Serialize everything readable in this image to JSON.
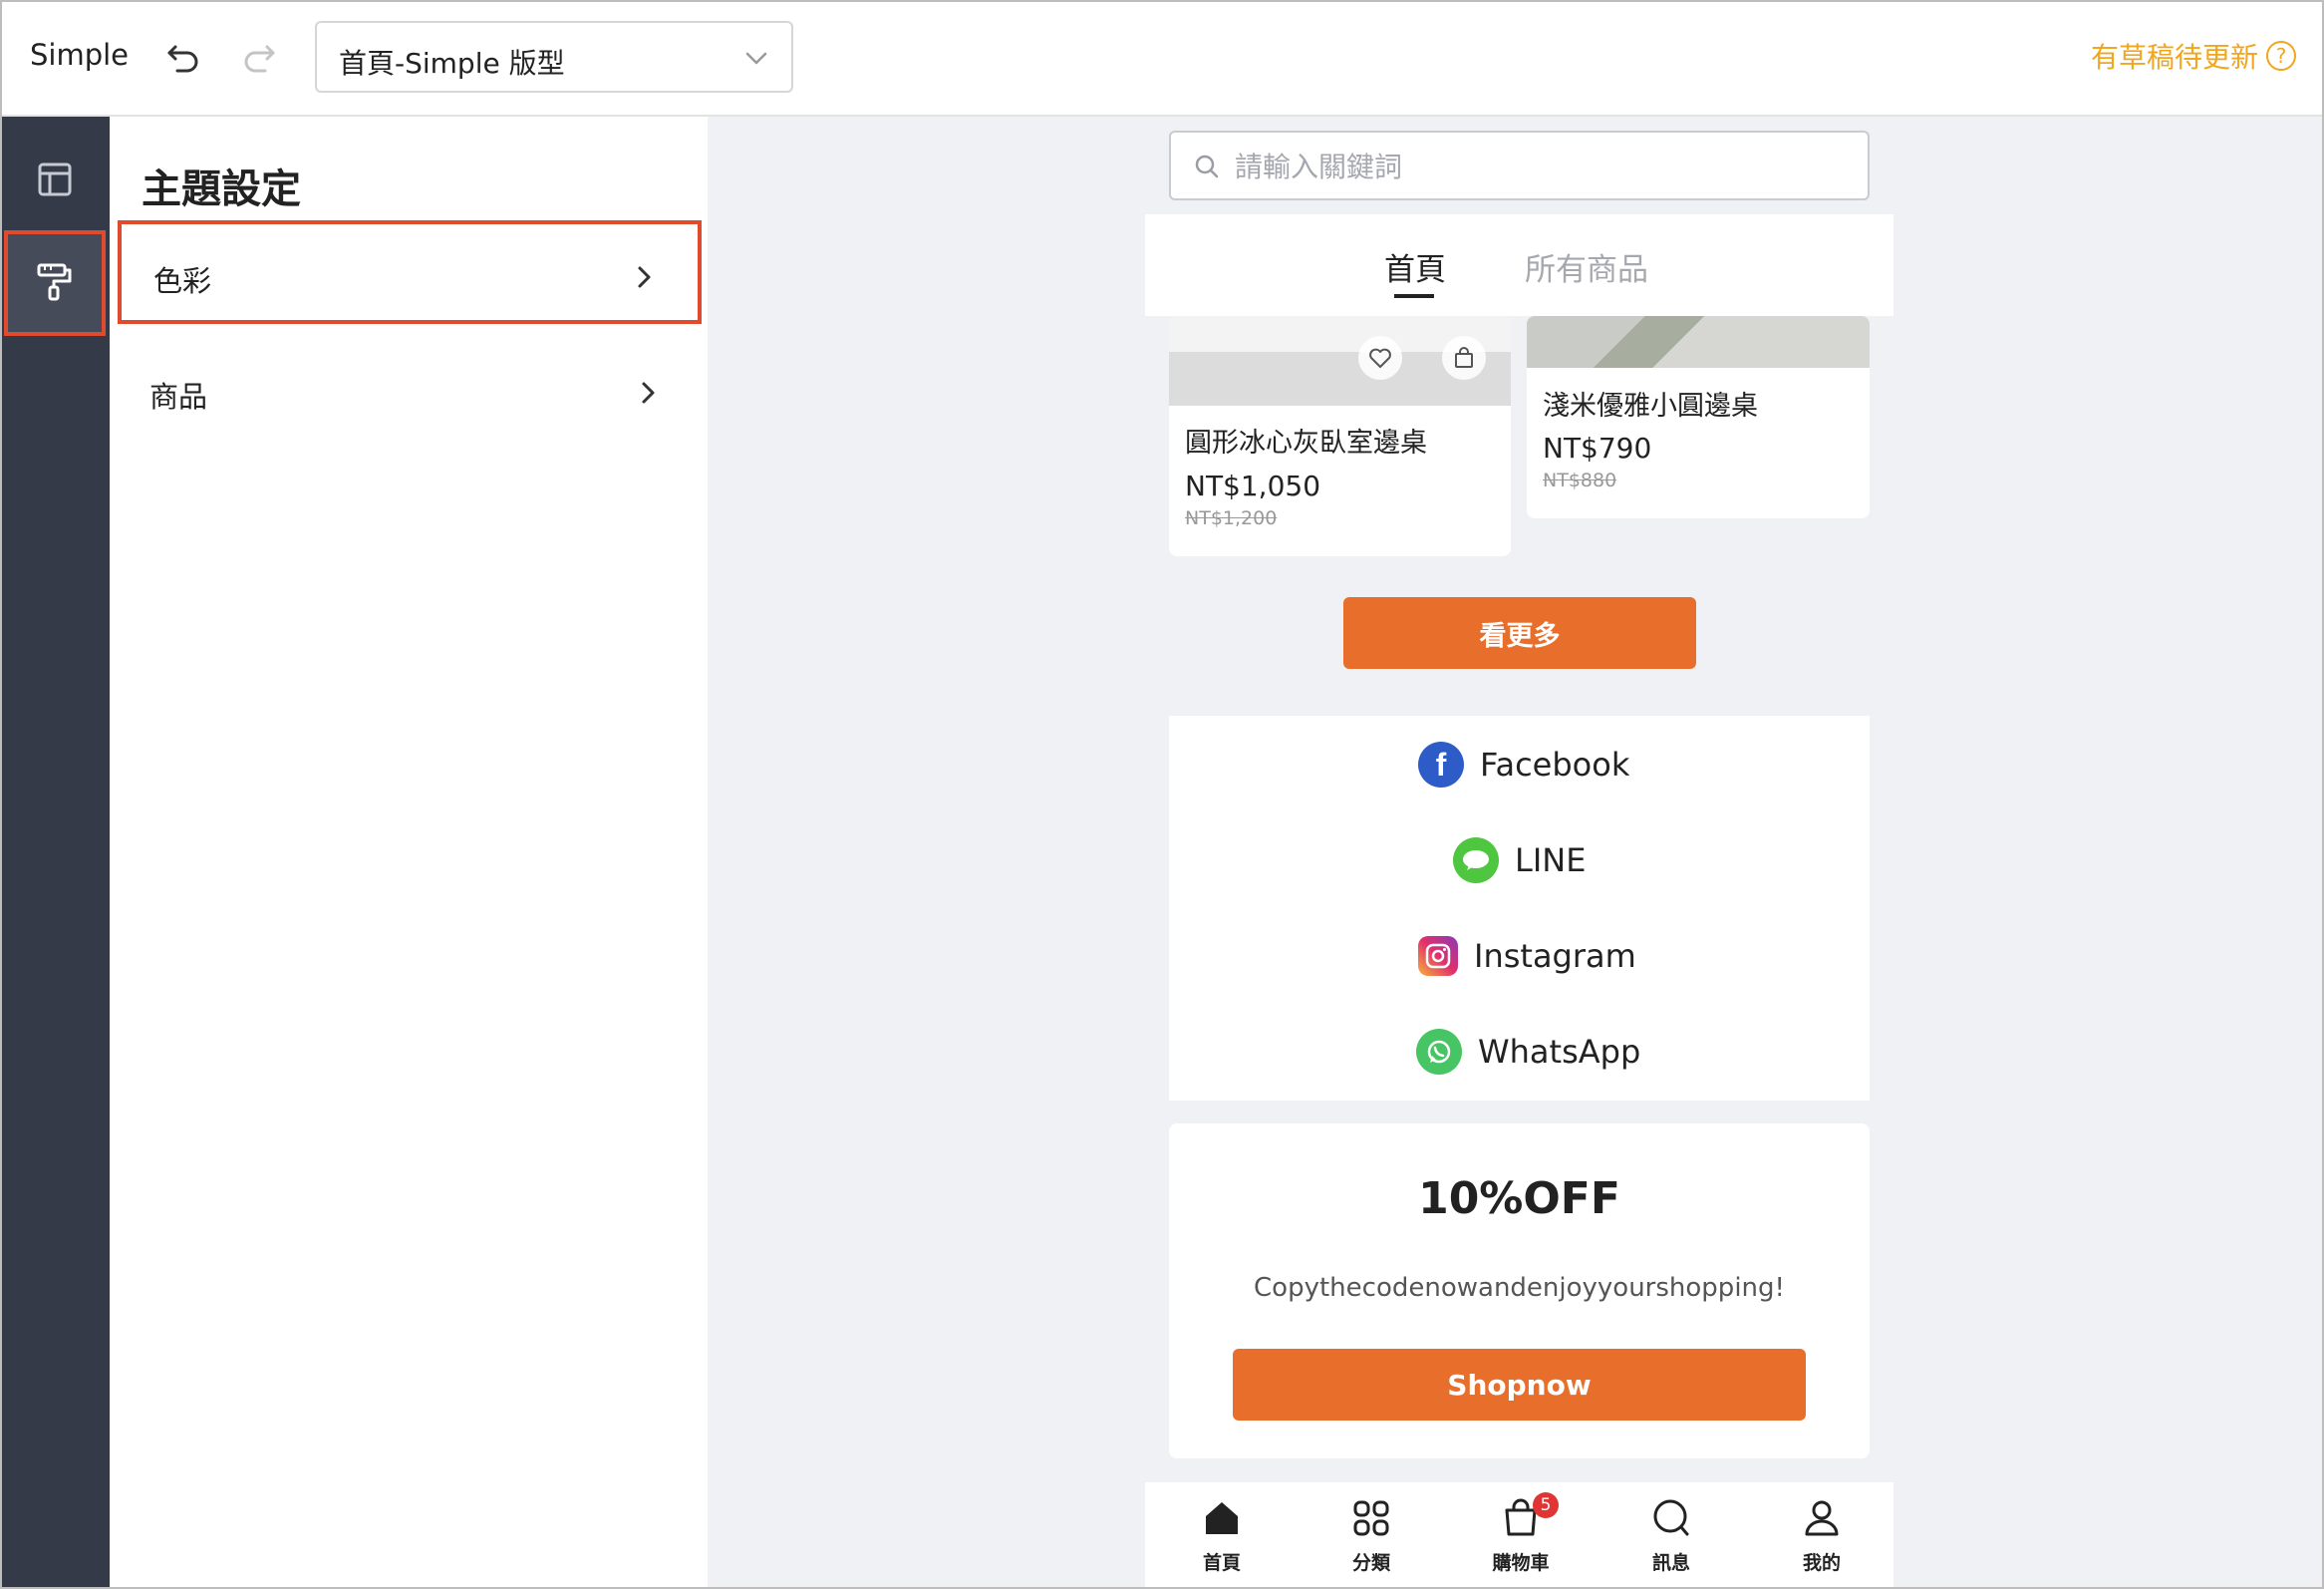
{
  "header": {
    "app_name": "Simple",
    "page_selector_value": "首頁-Simple 版型",
    "draft_notice": "有草稿待更新",
    "help_glyph": "?"
  },
  "rail": {
    "icons": [
      "layout-icon",
      "paint-roller-icon"
    ]
  },
  "panel": {
    "title": "主題設定",
    "items": [
      {
        "label": "色彩"
      },
      {
        "label": "商品"
      }
    ]
  },
  "preview": {
    "search_placeholder": "請輸入關鍵詞",
    "tabs": [
      {
        "label": "首頁"
      },
      {
        "label": "所有商品"
      }
    ],
    "products": [
      {
        "name": "圓形冰心灰臥室邊桌",
        "price": "NT$1,050",
        "original_price": "NT$1,200"
      },
      {
        "name": "淺米優雅小圓邊桌",
        "price": "NT$790",
        "original_price": "NT$880"
      }
    ],
    "more_button": "看更多",
    "social": [
      {
        "label": "Facebook"
      },
      {
        "label": "LINE"
      },
      {
        "label": "Instagram"
      },
      {
        "label": "WhatsApp"
      }
    ],
    "promo": {
      "title": "10%OFF",
      "subtitle": "Copythecodenowandenjoyyourshopping!",
      "button": "Shopnow"
    },
    "bottom_nav": [
      {
        "label": "首頁"
      },
      {
        "label": "分類"
      },
      {
        "label": "購物車",
        "badge": "5"
      },
      {
        "label": "訊息"
      },
      {
        "label": "我的"
      }
    ]
  },
  "colors": {
    "accent": "#e86e2b",
    "highlight": "#e04a2f",
    "draft": "#f0a61e",
    "rail": "#353a48"
  }
}
